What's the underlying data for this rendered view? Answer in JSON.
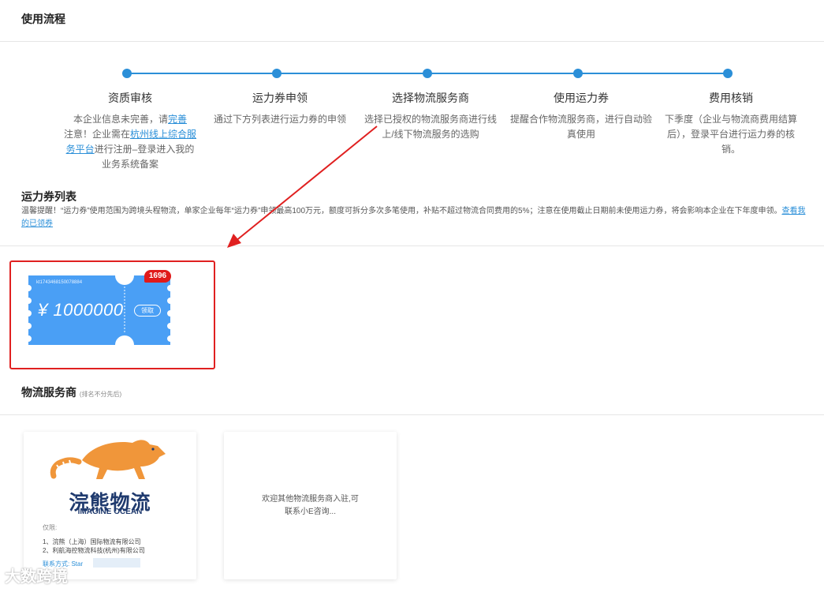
{
  "process": {
    "title": "使用流程",
    "steps": [
      {
        "title": "资质审核",
        "desc_pre": "本企业信息未完善，请",
        "desc_link1": "完善",
        "desc_mid": "注意！企业需在",
        "desc_link2": "杭州线上综合服务平台",
        "desc_post": "进行注册–登录进入我的业务系统备案"
      },
      {
        "title": "运力券申领",
        "desc": "通过下方列表进行运力券的申领"
      },
      {
        "title": "选择物流服务商",
        "desc": "选择已授权的物流服务商进行线上/线下物流服务的选购"
      },
      {
        "title": "使用运力券",
        "desc": "提醒合作物流服务商，进行自动验真使用"
      },
      {
        "title": "费用核销",
        "desc": "下季度（企业与物流商费用结算后），登录平台进行运力券的核销。"
      }
    ]
  },
  "coupons": {
    "title": "运力券列表",
    "notice": "温馨提醒！“运力券”使用范围为跨境头程物流，单家企业每年“运力券”申领最高100万元，额度可拆分多次多笔使用，补贴不超过物流合同费用的5%；注意在使用截止日期前未使用运力券，将会影响本企业在下年度申领。",
    "notice_link": "查看我的已领券",
    "items": [
      {
        "id": "kt1743468150078884",
        "amount": "¥ 1000000",
        "claim_label": "领取",
        "badge": "1696"
      }
    ]
  },
  "providers": {
    "title": "物流服务商",
    "subtitle": "(排名不分先后)",
    "cards": [
      {
        "logo_cn": "浣熊物流",
        "logo_en": "IMAGINE OCEAN",
        "limit_label": "仅限:",
        "companies": [
          "1、浣熊（上海）国际物流有限公司",
          "2、利航海控物流科技(杭州)有限公司"
        ],
        "contact": "联系方式: Star"
      }
    ],
    "welcome_line1": "欢迎其他物流服务商入驻,可",
    "welcome_line2": "联系小E咨询..."
  },
  "watermark": "大数跨境",
  "colors": {
    "accent": "#2b8fd8",
    "coupon": "#4a9ff5",
    "badge": "#e01a1a",
    "highlight": "#e02020",
    "logo_orange": "#f0963a",
    "logo_navy": "#1f3a6e"
  }
}
